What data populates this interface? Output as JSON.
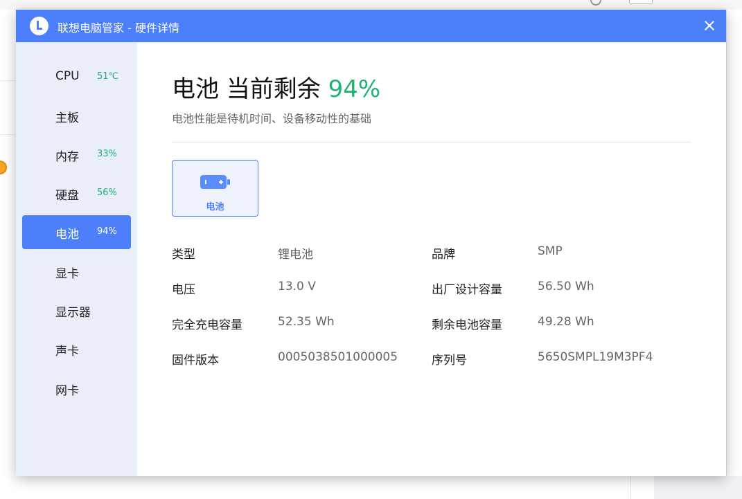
{
  "dialog": {
    "title": "联想电脑管家 - 硬件详情",
    "close_icon": "close-icon"
  },
  "sidebar": {
    "items": [
      {
        "label": "CPU",
        "value": "51℃",
        "active": false
      },
      {
        "label": "主板",
        "value": "",
        "active": false
      },
      {
        "label": "内存",
        "value": "33%",
        "active": false
      },
      {
        "label": "硬盘",
        "value": "56%",
        "active": false
      },
      {
        "label": "电池",
        "value": "94%",
        "active": true
      },
      {
        "label": "显卡",
        "value": "",
        "active": false
      },
      {
        "label": "显示器",
        "value": "",
        "active": false
      },
      {
        "label": "声卡",
        "value": "",
        "active": false
      },
      {
        "label": "网卡",
        "value": "",
        "active": false
      }
    ]
  },
  "main": {
    "heading_prefix": "电池 当前剩余 ",
    "heading_percent": "94%",
    "subtitle": "电池性能是待机时间、设备移动性的基础",
    "device_tile": {
      "label": "电池",
      "icon": "battery-icon"
    },
    "specs": [
      {
        "label": "类型",
        "value": "锂电池"
      },
      {
        "label": "品牌",
        "value": "SMP"
      },
      {
        "label": "电压",
        "value": "13.0 V"
      },
      {
        "label": "出厂设计容量",
        "value": "56.50 Wh"
      },
      {
        "label": "完全充电容量",
        "value": "52.35 Wh"
      },
      {
        "label": "剩余电池容量",
        "value": "49.28 Wh"
      },
      {
        "label": "固件版本",
        "value": "0005038501000005"
      },
      {
        "label": "序列号",
        "value": "5650SMPL19M3PF4"
      }
    ]
  },
  "colors": {
    "accent": "#4e7ffa",
    "good": "#1fb373",
    "sidebar_bg": "#eaeef8"
  }
}
